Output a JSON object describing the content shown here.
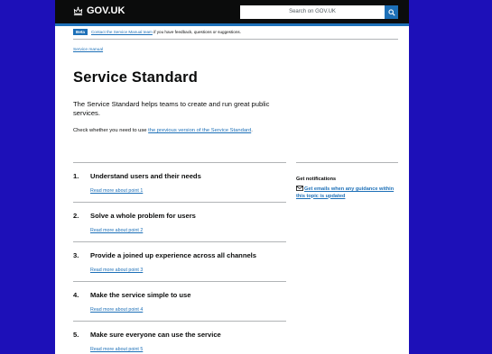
{
  "header": {
    "logo_text": "GOV.UK",
    "search_placeholder": "Search on GOV.UK",
    "colors": {
      "bar": "#0b0c0c",
      "accent": "#1d70b8"
    }
  },
  "phase_banner": {
    "tag": "Beta",
    "link_text": "Contact the Service Manual team",
    "rest_text": " if you have feedback, questions or suggestions."
  },
  "breadcrumb": {
    "item": "Service manual"
  },
  "page": {
    "title": "Service Standard",
    "lead": "The Service Standard helps teams to create and run great public services.",
    "check_text": "Check whether you need to use ",
    "check_link": "the previous version of the Service Standard",
    "check_end": "."
  },
  "points": [
    {
      "num": "1.",
      "title": "Understand users and their needs",
      "link": "Read more about point 1"
    },
    {
      "num": "2.",
      "title": "Solve a whole problem for users",
      "link": "Read more about point 2"
    },
    {
      "num": "3.",
      "title": "Provide a joined up experience across all channels",
      "link": "Read more about point 3"
    },
    {
      "num": "4.",
      "title": "Make the service simple to use",
      "link": "Read more about point 4"
    },
    {
      "num": "5.",
      "title": "Make sure everyone can use the service",
      "link": "Read more about point 5"
    }
  ],
  "sidebar": {
    "title": "Get notifications",
    "link_text": "Get emails when any guidance within this topic is updated",
    "icon": "mail-icon"
  },
  "background_color": "#1d10b8"
}
